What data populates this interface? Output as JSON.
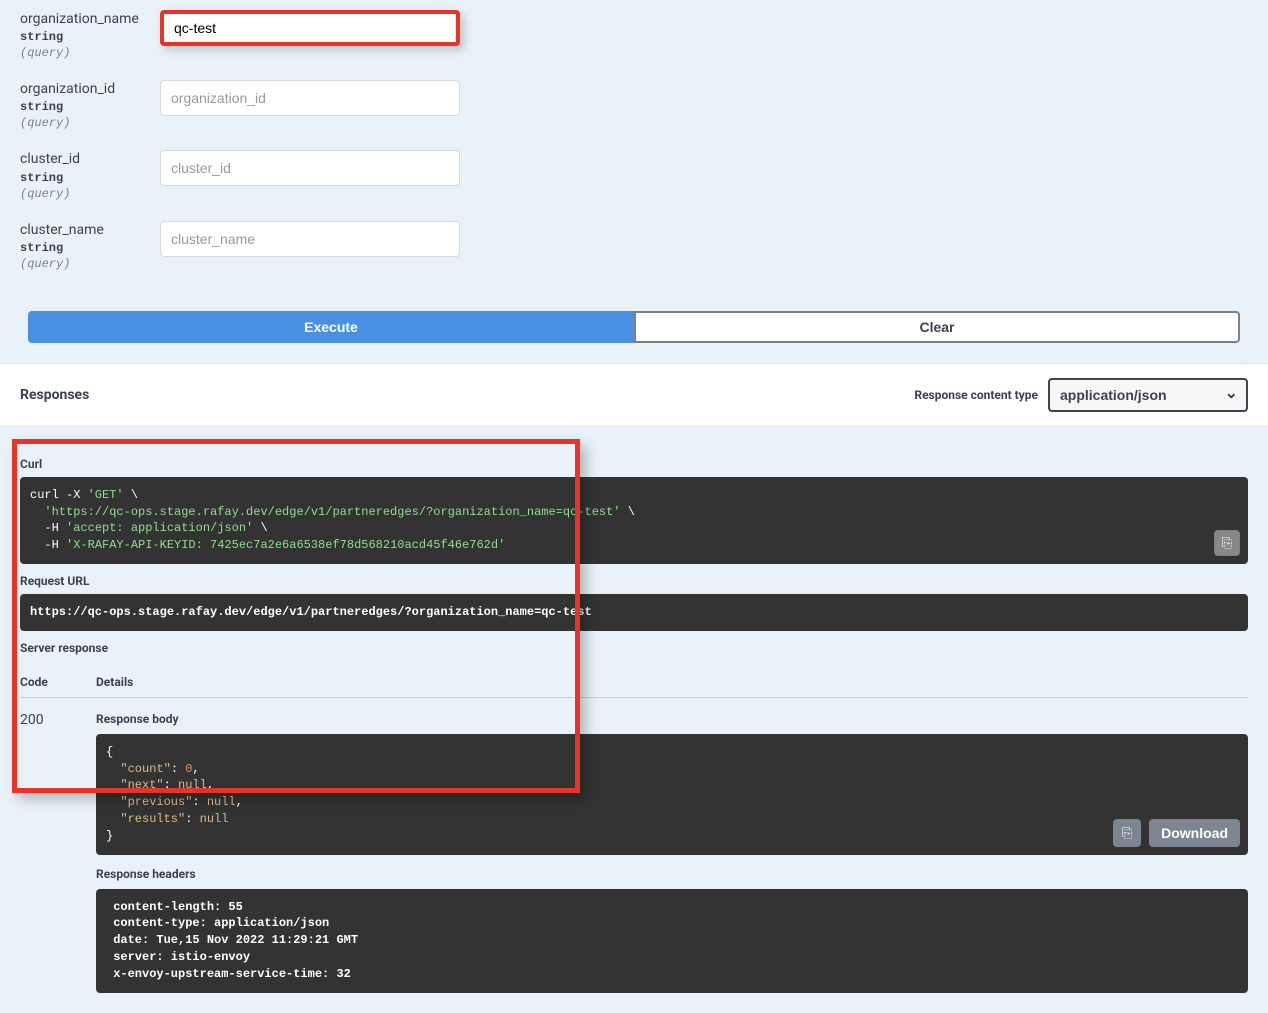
{
  "parameters": [
    {
      "name": "organization_name",
      "type": "string",
      "in": "(query)",
      "value": "qc-test",
      "placeholder": "organization_name",
      "highlight": true
    },
    {
      "name": "organization_id",
      "type": "string",
      "in": "(query)",
      "value": "",
      "placeholder": "organization_id",
      "highlight": false
    },
    {
      "name": "cluster_id",
      "type": "string",
      "in": "(query)",
      "value": "",
      "placeholder": "cluster_id",
      "highlight": false
    },
    {
      "name": "cluster_name",
      "type": "string",
      "in": "(query)",
      "value": "",
      "placeholder": "cluster_name",
      "highlight": false
    }
  ],
  "buttons": {
    "execute": "Execute",
    "clear": "Clear"
  },
  "responses": {
    "title": "Responses",
    "content_type_label": "Response content type",
    "content_type_value": "application/json"
  },
  "curl": {
    "label": "Curl",
    "line1_a": "curl -X ",
    "line1_b": "'GET'",
    "line1_c": " \\",
    "line2": "  'https://qc-ops.stage.rafay.dev/edge/v1/partneredges/?organization_name=qc-test'",
    "line2_c": " \\",
    "line3_a": "  -H ",
    "line3_b": "'accept: application/json'",
    "line3_c": " \\",
    "line4_a": "  -H ",
    "line4_b": "'X-RAFAY-API-KEYID: 7425ec7a2e6a6538ef78d568210acd45f46e762d'"
  },
  "request_url": {
    "label": "Request URL",
    "value": "https://qc-ops.stage.rafay.dev/edge/v1/partneredges/?organization_name=qc-test"
  },
  "server_response_label": "Server response",
  "table": {
    "code_head": "Code",
    "detail_head": "Details",
    "code_value": "200"
  },
  "response_body": {
    "label": "Response body",
    "json": {
      "l1": "{",
      "l2a": "  \"count\"",
      "l2b": ": ",
      "l2c": "0",
      "l2d": ",",
      "l3a": "  \"next\"",
      "l3b": ": ",
      "l3c": "null",
      "l3d": ",",
      "l4a": "  \"previous\"",
      "l4b": ": ",
      "l4c": "null",
      "l4d": ",",
      "l5a": "  \"results\"",
      "l5b": ": ",
      "l5c": "null",
      "l6": "}"
    },
    "download": "Download"
  },
  "response_headers": {
    "label": "Response headers",
    "text": " content-length: 55\n content-type: application/json\n date: Tue,15 Nov 2022 11:29:21 GMT\n server: istio-envoy\n x-envoy-upstream-service-time: 32"
  }
}
